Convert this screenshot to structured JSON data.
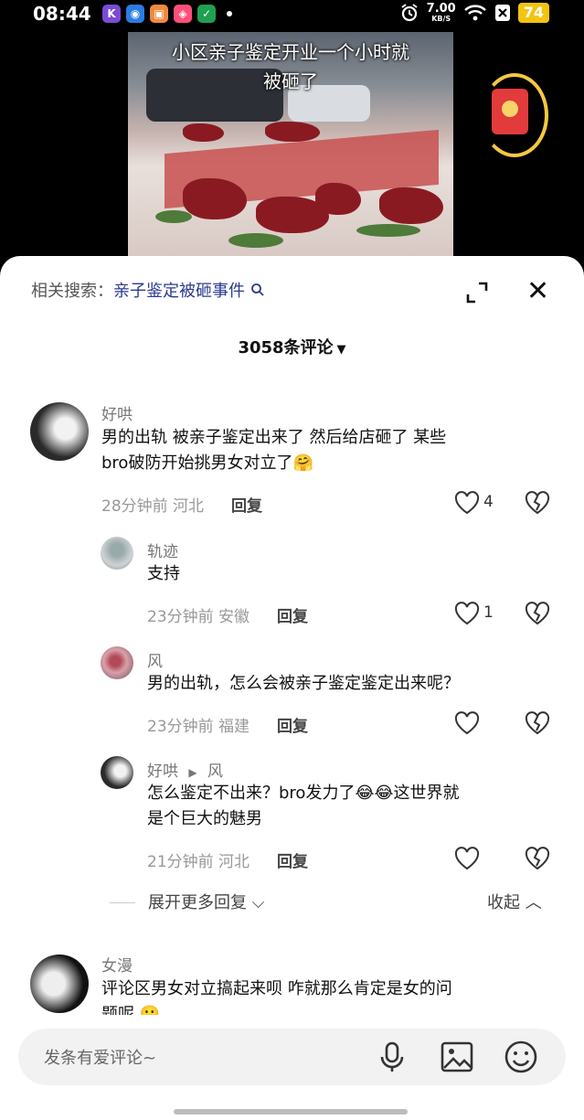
{
  "status_bar": {
    "time": "08:44",
    "net_speed_value": "7.00",
    "net_speed_unit": "KB/S",
    "battery": "74",
    "app_icons": [
      "k-icon",
      "browser-icon",
      "photo-app-icon",
      "shop-app-icon",
      "shield-app-icon"
    ]
  },
  "video": {
    "caption_line1": "小区亲子鉴定开业一个小时就",
    "caption_line2": "被砸了"
  },
  "panel": {
    "related_label": "相关搜索：",
    "related_keyword": "亲子鉴定被砸事件",
    "comment_count": "3058条评论"
  },
  "comments": [
    {
      "user": "好哄",
      "text_line1": "男的出轨 被亲子鉴定出来了 然后给店砸了 某些",
      "text_line2": "bro破防开始挑男女对立了🤗",
      "time": "28分钟前",
      "location": "河北",
      "reply_label": "回复",
      "likes": "4"
    },
    {
      "user": "轨迹",
      "text_line1": "支持",
      "time": "23分钟前",
      "location": "安徽",
      "reply_label": "回复",
      "likes": "1"
    },
    {
      "user": "风",
      "text_line1": "男的出轨，怎么会被亲子鉴定鉴定出来呢？",
      "time": "23分钟前",
      "location": "福建",
      "reply_label": "回复",
      "likes": ""
    },
    {
      "user": "好哄",
      "reply_to": "风",
      "text_line1": "怎么鉴定不出来？bro发力了😂😂这世界就",
      "text_line2": "是个巨大的魅男",
      "time": "21分钟前",
      "location": "河北",
      "reply_label": "回复",
      "likes": ""
    },
    {
      "user": "女漫",
      "text_line1": "评论区男女对立搞起来呗 咋就那么肯定是女的问",
      "text_line2": "题呢 😬"
    }
  ],
  "more_replies": "展开更多回复",
  "collapse": "收起",
  "input": {
    "placeholder": "发条有爱评论~"
  },
  "colors": {
    "battery": "#f1c40f",
    "keyword": "#2a3a8f",
    "red_packet": "#e23b3b",
    "ring": "#f5c842"
  }
}
